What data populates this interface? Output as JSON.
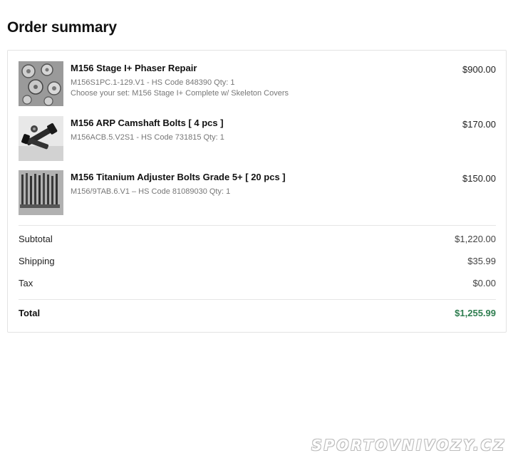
{
  "title": "Order summary",
  "items": [
    {
      "name": "M156 Stage I+ Phaser Repair",
      "meta1": "M156S1PC.1-129.V1 - HS Code 848390 Qty: 1",
      "meta2": "Choose your set: M156 Stage I+ Complete w/ Skeleton Covers",
      "price": "$900.00",
      "icon": "phaser-parts-image"
    },
    {
      "name": "M156 ARP Camshaft Bolts [ 4 pcs ]",
      "meta1": "M156ACB.5.V2S1 - HS Code 731815 Qty: 1",
      "price": "$170.00",
      "icon": "camshaft-bolts-image"
    },
    {
      "name": "M156 Titanium Adjuster Bolts Grade 5+ [ 20 pcs ]",
      "meta1": "M156/9TAB.6.V1 – HS Code 81089030 Qty: 1",
      "price": "$150.00",
      "icon": "titanium-bolts-image"
    }
  ],
  "summary": {
    "subtotal_label": "Subtotal",
    "subtotal_value": "$1,220.00",
    "shipping_label": "Shipping",
    "shipping_value": "$35.99",
    "tax_label": "Tax",
    "tax_value": "$0.00",
    "total_label": "Total",
    "total_value": "$1,255.99"
  },
  "watermark": "SPORTOVNIVOZY.CZ",
  "colors": {
    "total_accent": "#2e7d4f"
  }
}
